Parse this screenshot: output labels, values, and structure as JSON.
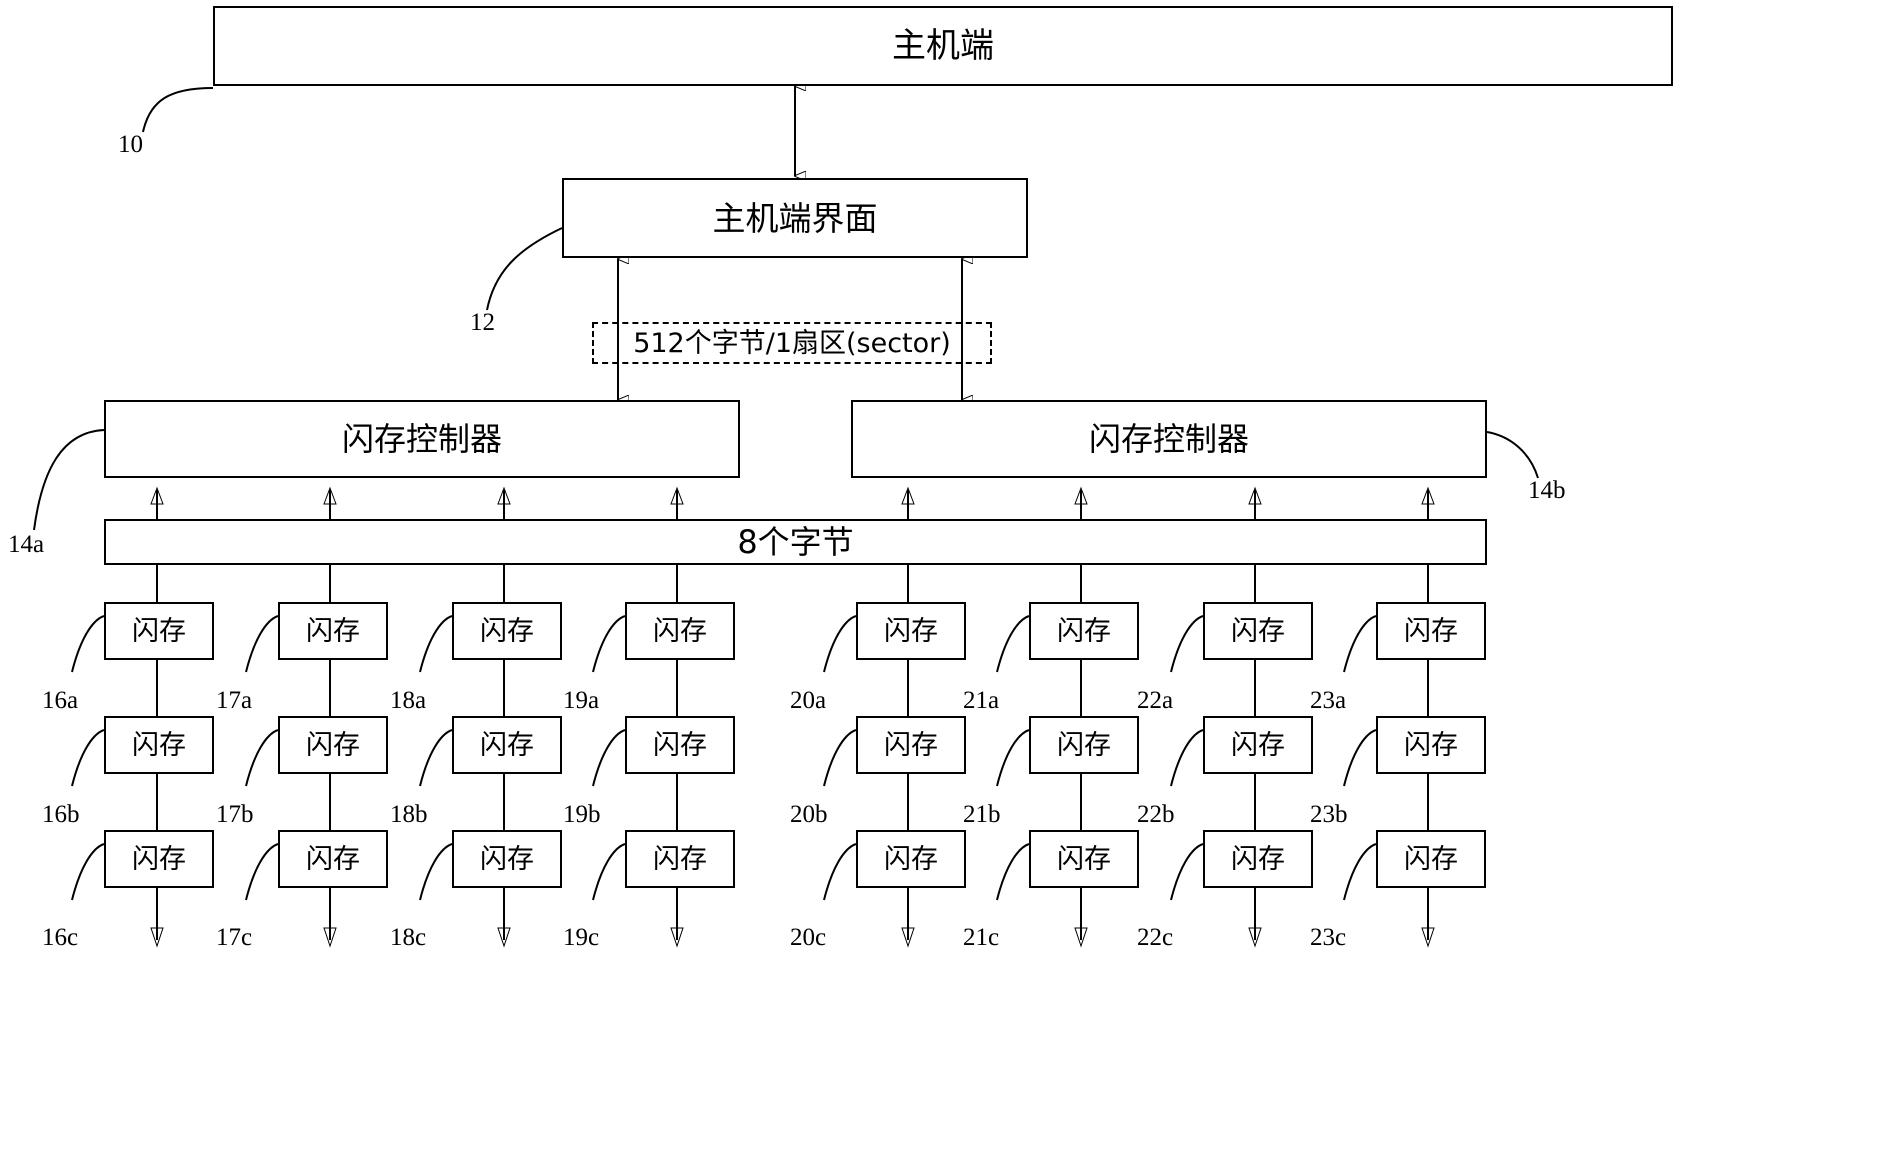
{
  "diagram": {
    "title_host": "主机端",
    "title_interface": "主机端界面",
    "sector_note": "512个字节/1扇区(sector)",
    "controller_label": "闪存控制器",
    "bus_label": "8个字节",
    "flash_label": "闪存"
  },
  "refs": {
    "host": "10",
    "interface": "12",
    "controller_left": "14a",
    "controller_right": "14b"
  },
  "columns": [
    {
      "id": "col-16",
      "refs": [
        "16a",
        "16b",
        "16c"
      ]
    },
    {
      "id": "col-17",
      "refs": [
        "17a",
        "17b",
        "17c"
      ]
    },
    {
      "id": "col-18",
      "refs": [
        "18a",
        "18b",
        "18c"
      ]
    },
    {
      "id": "col-19",
      "refs": [
        "19a",
        "19b",
        "19c"
      ]
    },
    {
      "id": "col-20",
      "refs": [
        "20a",
        "20b",
        "20c"
      ]
    },
    {
      "id": "col-21",
      "refs": [
        "21a",
        "21b",
        "21c"
      ]
    },
    {
      "id": "col-22",
      "refs": [
        "22a",
        "22b",
        "22c"
      ]
    },
    {
      "id": "col-23",
      "refs": [
        "23a",
        "23b",
        "23c"
      ]
    }
  ],
  "flash_cells": {
    "labels": [
      [
        "闪存",
        "闪存",
        "闪存",
        "闪存",
        "闪存",
        "闪存",
        "闪存",
        "闪存"
      ],
      [
        "闪存",
        "闪存",
        "闪存",
        "闪存",
        "闪存",
        "闪存",
        "闪存",
        "闪存"
      ],
      [
        "闪存",
        "闪存",
        "闪存",
        "闪存",
        "闪存",
        "闪存",
        "闪存",
        "闪存"
      ]
    ]
  },
  "colors": {
    "stroke": "#000000",
    "background": "#ffffff"
  }
}
